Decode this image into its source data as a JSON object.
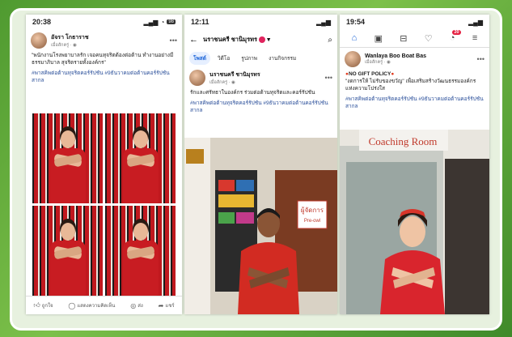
{
  "phone1": {
    "status": {
      "time": "20:38",
      "battery": "98"
    },
    "author": "อัจรา โกธาราช",
    "meta": "เมื่อสักครู่ · ",
    "text": "\"พนักงานโรงพยาบาลรัก เจอคนทุจริตต้องต่อต้าน ทำงานอย่างมีธรรมาภิบาล สุจริตรายทั้งองค์กร\"",
    "tags": "#พาสคิพต่อต้านทุจริตคอร์รัปชัน #9ธันวาคมต่อต้านคอร์รัปชันสากล",
    "actions": [
      {
        "icon": "like-icon",
        "label": "ถูกใจ"
      },
      {
        "icon": "comment-icon",
        "label": "แสดงความคิดเห็น"
      },
      {
        "icon": "share-icon",
        "label": "ส่ง"
      },
      {
        "icon": "forward-icon",
        "label": "แชร์"
      }
    ]
  },
  "phone2": {
    "status": {
      "time": "12:11"
    },
    "title": "นราชนครี ชานิมุรทร",
    "tabs": [
      "โพสต์",
      "วิดีโอ",
      "รูปภาพ",
      "งานกิจกรรม"
    ],
    "author": "นราชนครี ชานิมุรทร",
    "meta": "เมื่อสักครู่ · ",
    "text": "รักและศรัทธาในองค์กร ร่วมต่อต้านทุจริตและคอร์รัปชัน",
    "tags": "#พาสคิพต่อต้านทุจริตคอร์รัปชัน #9ธันวาคมต่อต้านคอร์รัปชันสากล",
    "sign": "ผู้จัดการ",
    "sign2": "Pre-owl"
  },
  "phone3": {
    "status": {
      "time": "19:54"
    },
    "author": "Wanlaya Boo Boat Bas",
    "meta": "เมื่อสักครู่ · ",
    "policy": "NO GIFT POLICY",
    "text": "\"งดการให้ ไม่รับของขวัญ\" เพื่อเสริมสร้างวัฒนธรรมองค์กร แห่งความโปร่งใส",
    "tags": "#พาสคิพต่อต้านทุจริตคอร์รัปชัน #9ธันวาคมต่อต้านคอร์รัปชันสากล",
    "room_sign": "Coaching Room",
    "notif_badge": "20"
  }
}
